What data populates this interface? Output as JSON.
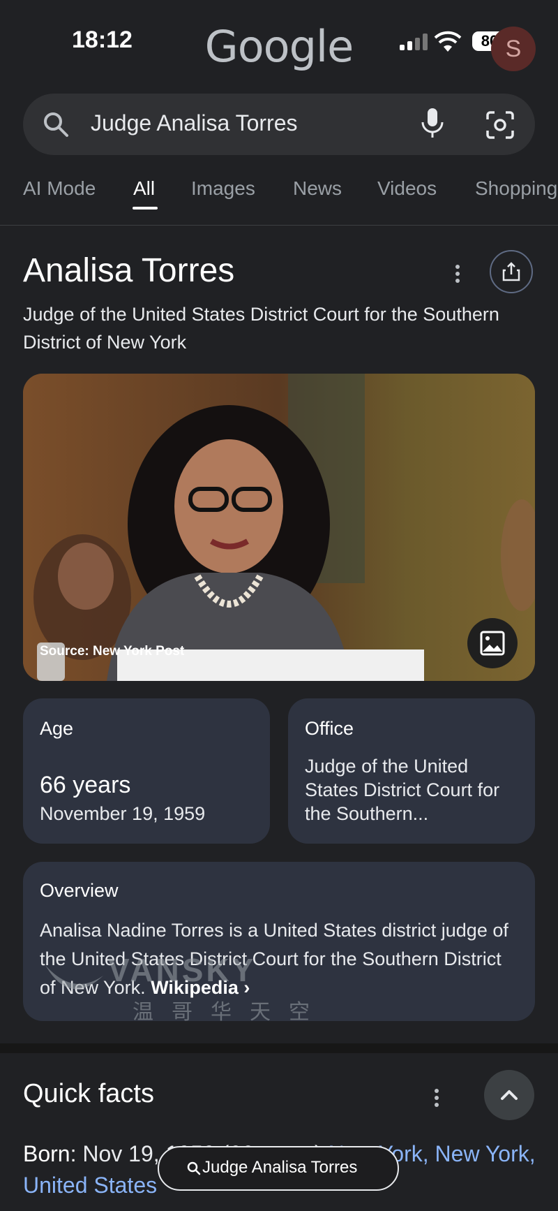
{
  "status": {
    "time": "18:12",
    "battery": "80",
    "avatar_letter": "S"
  },
  "brand": {
    "logo": "Google"
  },
  "search": {
    "query": "Judge Analisa Torres"
  },
  "tabs": [
    {
      "label": "AI Mode"
    },
    {
      "label": "All",
      "active": true
    },
    {
      "label": "Images"
    },
    {
      "label": "News"
    },
    {
      "label": "Videos"
    },
    {
      "label": "Shopping"
    }
  ],
  "knowledge_panel": {
    "title": "Analisa Torres",
    "subtitle": "Judge of the United States District Court for the Southern District of New York",
    "image_source": "Source: New York Post",
    "age_card": {
      "label": "Age",
      "value": "66 years",
      "detail": "November 19, 1959"
    },
    "office_card": {
      "label": "Office",
      "value": "Judge of the United States District Court for the Southern..."
    },
    "overview_card": {
      "label": "Overview",
      "text": "Analisa Nadine Torres is a United States district judge of the United States District Court for the Southern District of New York.",
      "link": "Wikipedia ›"
    }
  },
  "quick_facts": {
    "title": "Quick facts",
    "born_label": "Born:",
    "born_value": " Nov 19, 1959 (66 years) ",
    "born_place": "New York, New York, United States"
  },
  "floating_search": {
    "text": "Judge Analisa Torres"
  },
  "watermark": {
    "text": "VANSKY",
    "subtext": "温哥华天空"
  },
  "colors": {
    "background": "#202124",
    "card": "#2e3340",
    "link": "#8ab4f8"
  }
}
